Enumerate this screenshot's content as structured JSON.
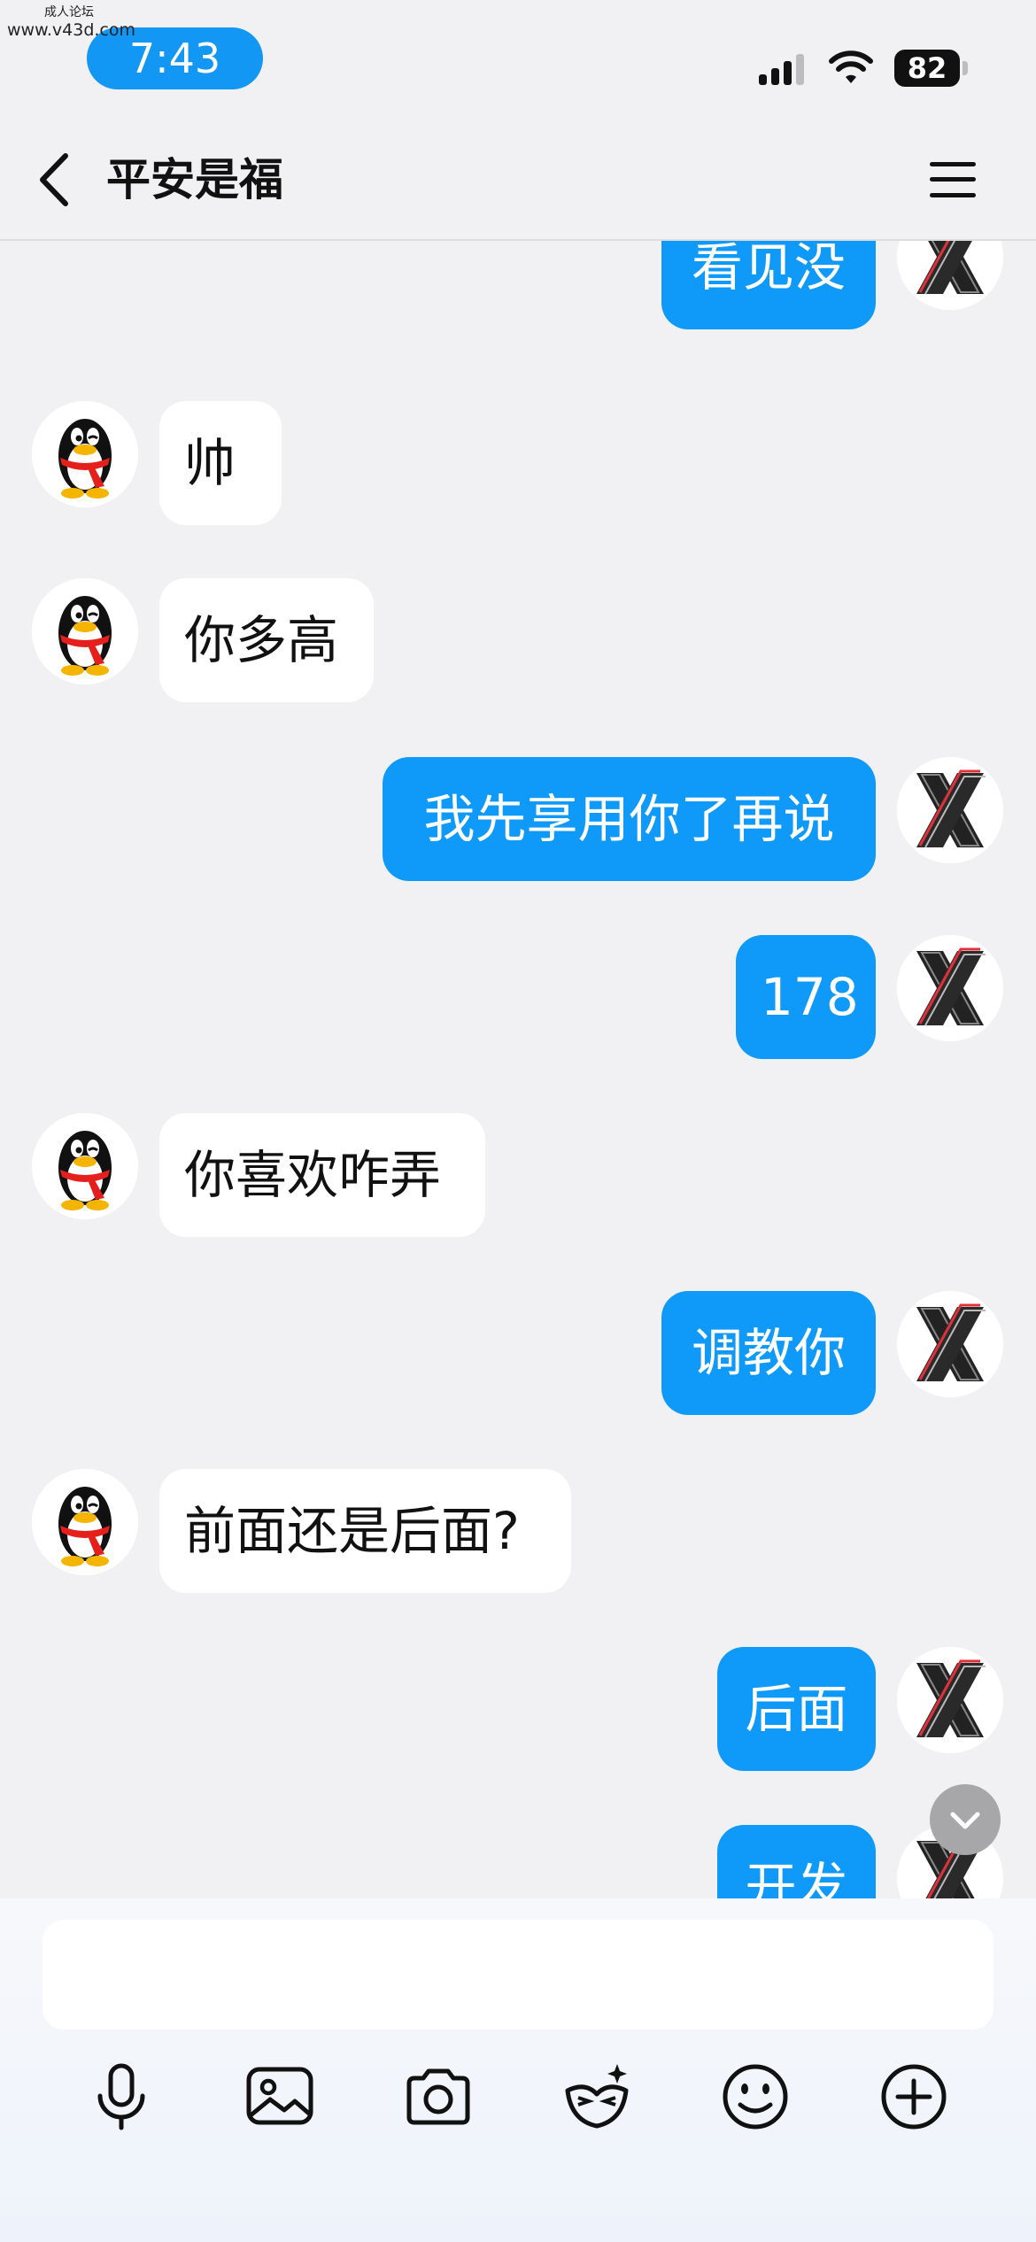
{
  "watermark": {
    "top": "成人论坛",
    "url": "www.v43d.com"
  },
  "status_bar": {
    "time": "7:43",
    "battery": "82"
  },
  "header": {
    "title": "平安是福"
  },
  "messages": [
    {
      "from": "me",
      "text": "看见没"
    },
    {
      "from": "peer",
      "text": "帅"
    },
    {
      "from": "peer",
      "text": "你多高"
    },
    {
      "from": "me",
      "text": "我先享用你了再说"
    },
    {
      "from": "me",
      "text": "178"
    },
    {
      "from": "peer",
      "text": "你喜欢咋弄"
    },
    {
      "from": "me",
      "text": "调教你"
    },
    {
      "from": "peer",
      "text": "前面还是后面?"
    },
    {
      "from": "me",
      "text": "后面"
    },
    {
      "from": "me",
      "text": "开发"
    }
  ],
  "composer": {
    "input_value": "",
    "tools": [
      "microphone-icon",
      "image-icon",
      "camera-icon",
      "mask-icon",
      "emoji-icon",
      "plus-icon"
    ]
  },
  "colors": {
    "accent": "#0f99f9",
    "status_pill": "#1297f5",
    "background": "#f1f1f3"
  }
}
